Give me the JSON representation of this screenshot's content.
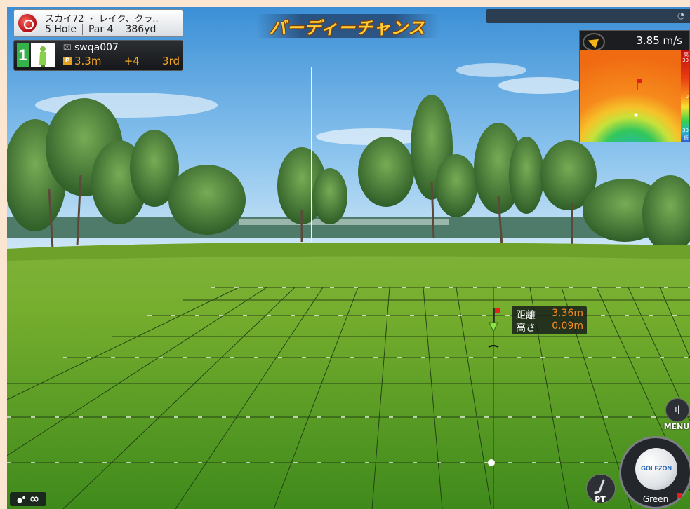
{
  "course": {
    "name": "スカイ72 ・ レイク、クラ..",
    "hole": "5 Hole",
    "par": "Par 4",
    "yardage": "386yd"
  },
  "player": {
    "rank": "1",
    "name": "swqa007",
    "distance": "3.3m",
    "score": "+4",
    "stroke": "3rd",
    "badge": "P"
  },
  "banner": {
    "text": "バーディーチャンス"
  },
  "wind": {
    "speed": "3.85 m/s",
    "legend": [
      "高",
      "30",
      "0",
      "30",
      "低"
    ]
  },
  "putt_info": {
    "distance_label": "距離",
    "distance_value": "3.36m",
    "height_label": "高さ",
    "height_value": "0.09m"
  },
  "menu": {
    "label": "MENU"
  },
  "pt": {
    "label": "PT"
  },
  "club": {
    "label": "Green",
    "ball_brand": "GOLFZON"
  },
  "infinity": {
    "symbol": "∞"
  },
  "colors": {
    "accent_orange": "#ff8c1c",
    "banner_gold": "#ffcf3a",
    "rank_green": "#36b24a"
  },
  "icons": [
    "course-logo-icon",
    "golfer-icon",
    "device-icon",
    "wind-arrow-icon",
    "menu-icon",
    "putter-icon",
    "ball-icon",
    "flag-icon",
    "shot-count-icon"
  ]
}
